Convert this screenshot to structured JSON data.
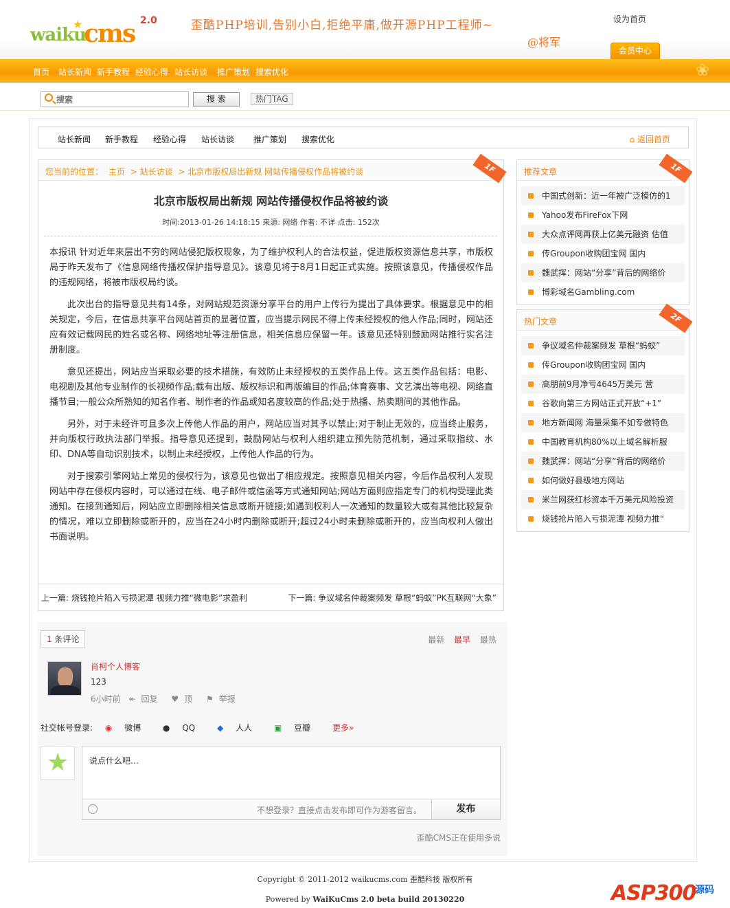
{
  "header": {
    "logo": {
      "w": "waiku",
      "c": "cms",
      "version": "2.0"
    },
    "slogan": "歪酷PHP培训,告别小白,拒绝平庸,做开源PHP工程师~",
    "author": "@将军",
    "set_home": "设为首页",
    "member_center": "会员中心",
    "nav": [
      "首页",
      "站长新闻",
      "新手教程",
      "经验心得",
      "站长访谈",
      "推广策划",
      "搜索优化"
    ]
  },
  "search": {
    "placeholder": "搜索",
    "button": "搜 索",
    "hot_tag": "热门TAG"
  },
  "subnav": {
    "items": [
      "站长新闻",
      "新手教程",
      "经验心得",
      "站长访谈",
      "推广策划",
      "搜索优化"
    ],
    "back_home": "返回首页"
  },
  "breadcrumb": [
    "您当前的位置：",
    "主页",
    "> 站长访谈",
    "> 北京市版权局出新规  网站传播侵权作品将被约谈"
  ],
  "ribbons": {
    "main": "1F",
    "side1": "1F",
    "side2": "2F"
  },
  "article": {
    "title": "北京市版权局出新规 网站传播侵权作品将被约谈",
    "meta": "时间:2013-01-26 14:18:15 来源: 网络  作者: 不详  点击: 152次",
    "paragraphs": [
      "本报讯 针对近年来层出不穷的网站侵犯版权现象，为了维护权利人的合法权益，促进版权资源信息共享，市版权局于昨天发布了《信息网络传播权保护指导意见》。该意见将于8月1日起正式实施。按照该意见，传播侵权作品的违规网络，将被市版权局约谈。",
      "此次出台的指导意见共有14条，对网站规范资源分享平台的用户上传行为提出了具体要求。根据意见中的相关规定，今后，在信息共享平台网站首页的显著位置，应当提示网民不得上传未经授权的他人作品;同时，网站还应有效记载网民的姓名或名称、网络地址等注册信息，相关信息应保留一年。该意见还特别鼓励网站推行实名注册制度。",
      "意见还提出，网站应当采取必要的技术措施，有效防止未经授权的五类作品上传。这五类作品包括：电影、电视剧及其他专业制作的长视频作品;载有出版、版权标识和再版编目的作品;体育赛事、文艺演出等电视、网络直播节目;一般公众所熟知的知名作者、制作者的作品或知名度较高的作品;处于热播、热卖期间的其他作品。",
      "另外，对于未经许可且多次上传他人作品的用户，网站应当对其予以禁止;对于制止无效的，应当终止服务，并向版权行政执法部门举报。指导意见还提到，鼓励网站与权利人组织建立预先防范机制，通过采取指纹、水印、DNA等自动识别技术，以制止未经授权，上传他人作品的行为。",
      "对于搜索引擎网站上常见的侵权行为，该意见也做出了相应规定。按照意见相关内容，今后作品权利人发现网站中存在侵权内容时，可以通过在线、电子邮件或信函等方式通知网站;网站方面则应指定专门的机构受理此类通知。在接到通知后，网站应立即删除相关信息或断开链接;如遇到权利人一次通知的数量较大或有其他比较复杂的情况，难以立即删除或断开的，应当在24小时内删除或断开;超过24小时未删除或断开的，应当向权利人做出书面说明。"
    ],
    "prev": "上一篇: 烧钱抢片陷入亏损泥潭 视频力推“微电影”求盈利",
    "next": "下一篇: 争议域名仲裁案频发 草根“蚂蚁”PK互联网“大象”"
  },
  "comments": {
    "count_num": "1",
    "count_label": "条评论",
    "sort": [
      "最新",
      "最早",
      "最热"
    ],
    "sort_active": 1,
    "item": {
      "name": "肖柯个人博客",
      "text": "123",
      "time": "6小时前",
      "reply": "回复",
      "up": "顶",
      "report": "举报"
    },
    "social_label": "社交帐号登录:",
    "social": [
      "微博",
      "QQ",
      "人人",
      "豆瓣"
    ],
    "more": "更多»",
    "placeholder": "说点什么吧…",
    "tip": "不想登录？直接点击发布即可作为游客留言。",
    "send": "发布",
    "using": "歪酷CMS正在使用多说"
  },
  "sidebar": {
    "recommend_title": "推荐文章",
    "recommend": [
      "中国式创新：近一年被广泛模仿的1",
      "Yahoo发布FireFox下网",
      "大众点评网再获上亿美元融资 估值",
      "传Groupon收购团宝网 国内",
      "魏武挥：网站“分享”背后的网络价",
      "博彩域名Gambling.com"
    ],
    "hot_title": "热门文章",
    "hot": [
      "争议域名仲裁案频发 草根“蚂蚁”",
      "传Groupon收购团宝网 国内",
      "高朋前9月净亏4645万美元 营",
      "谷歌向第三方网站正式开放“+1”",
      "地方新闻网 海量采集不如专做特色",
      "中国教育机构80%以上域名解析服",
      "魏武挥：网站“分享”背后的网络价",
      "如何做好县级地方网站",
      "米兰网获红杉资本千万美元风险投资",
      "烧钱抢片陷入亏损泥潭 视频力推“"
    ]
  },
  "footer": {
    "copyright": "Copyright © 2011-2012 waikucms.com 歪酷科技  版权所有",
    "powered_prefix": "Powered by",
    "powered": "WaiKuCms 2.0 beta build 20130220",
    "watermark_a": "ASP300",
    "watermark_b": "源码"
  }
}
